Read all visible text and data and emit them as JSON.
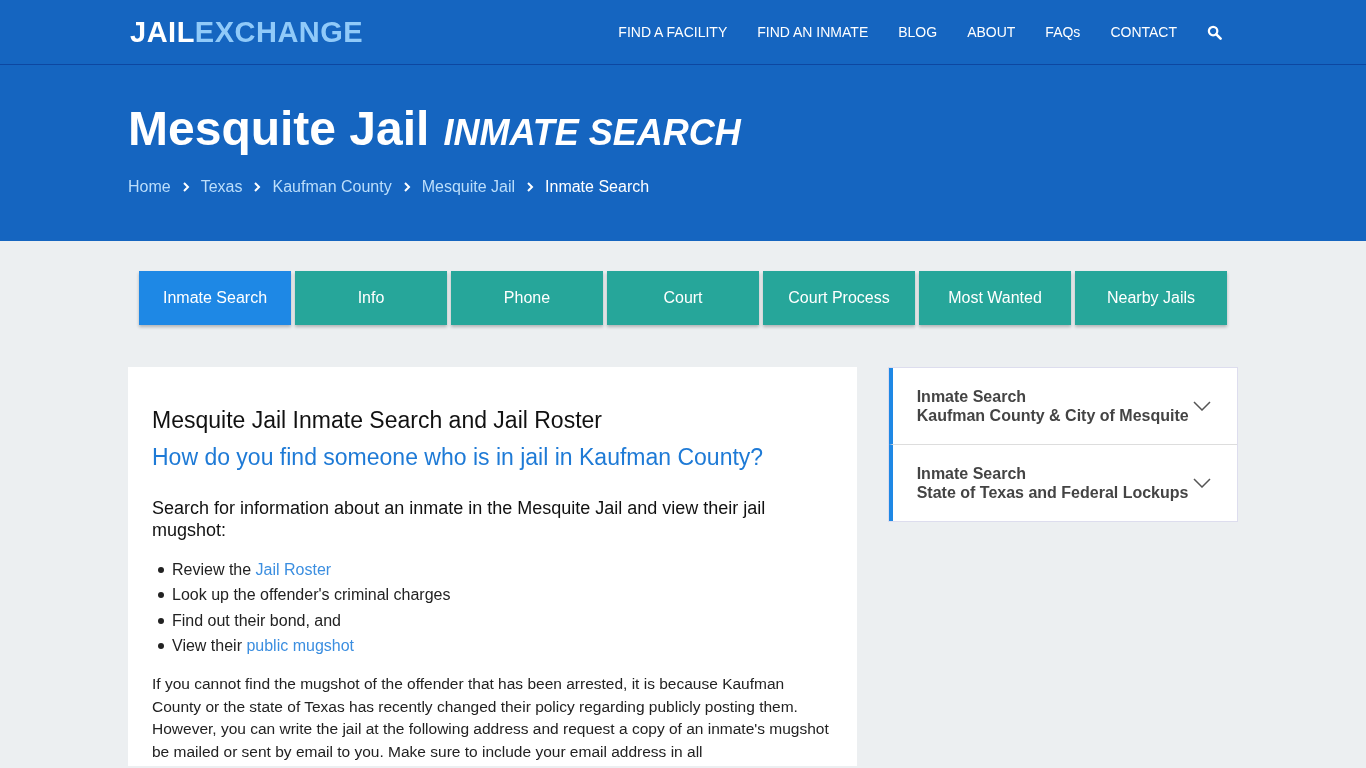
{
  "header": {
    "logo": {
      "part_1": "JAIL",
      "part_2": "EXCHANGE"
    },
    "nav": [
      "FIND A FACILITY",
      "FIND AN INMATE",
      "BLOG",
      "ABOUT",
      "FAQs",
      "CONTACT"
    ]
  },
  "hero": {
    "title": "Mesquite Jail",
    "subtitle": "INMATE SEARCH",
    "breadcrumbs": [
      {
        "label": "Home",
        "current": false
      },
      {
        "label": "Texas",
        "current": false
      },
      {
        "label": "Kaufman County",
        "current": false
      },
      {
        "label": "Mesquite Jail",
        "current": false
      },
      {
        "label": "Inmate Search",
        "current": true
      }
    ]
  },
  "tabs": [
    {
      "label": "Inmate Search",
      "selected": true
    },
    {
      "label": "Info",
      "selected": false
    },
    {
      "label": "Phone",
      "selected": false
    },
    {
      "label": "Court",
      "selected": false
    },
    {
      "label": "Court Process",
      "selected": false
    },
    {
      "label": "Most Wanted",
      "selected": false
    },
    {
      "label": "Nearby Jails",
      "selected": false
    }
  ],
  "article": {
    "heading": "Mesquite Jail Inmate Search and Jail Roster",
    "question": "How do you find someone who is in jail in Kaufman County?",
    "lead": "Search for information about an inmate in the Mesquite Jail and view their jail mugshot:",
    "bullets": [
      {
        "text": "Review the ",
        "link": "Jail Roster"
      },
      {
        "text": "Look up the offender's criminal charges"
      },
      {
        "text": "Find out their bond, and"
      },
      {
        "text": "View their ",
        "link": "public mugshot"
      }
    ],
    "paragraph": "If you cannot find the mugshot of the offender that has been arrested, it is because Kaufman County or the state of Texas has recently changed their policy regarding publicly posting them. However, you can write the jail at the following address and request a copy of an inmate's mugshot be mailed or sent by email to you. Make sure to include your email address in all"
  },
  "sidebar": [
    {
      "line_1": "Inmate Search",
      "line_2": "Kaufman County & City of Mesquite",
      "expanded": false
    },
    {
      "line_1": "Inmate Search",
      "line_2": "State of Texas and Federal Lockups",
      "expanded": false
    }
  ]
}
